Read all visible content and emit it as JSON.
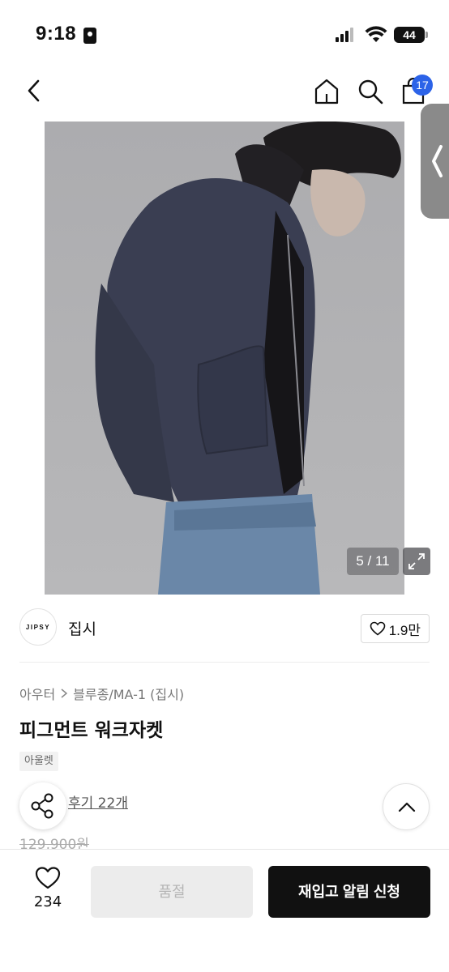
{
  "status_bar": {
    "time": "9:18",
    "battery": "44"
  },
  "nav": {
    "cart_count": "17"
  },
  "gallery": {
    "counter": "5 / 11"
  },
  "brand": {
    "logo_text": "JIPSY",
    "name": "집시",
    "likes": "1.9만"
  },
  "product": {
    "breadcrumb": [
      "아우터",
      "블루종/MA-1 (집시)"
    ],
    "title": "피그먼트 워크자켓",
    "badge": "아울렛",
    "review_link": "후기 22개",
    "original_price": "129,900원"
  },
  "bottom_bar": {
    "wish_count": "234",
    "soldout_label": "품절",
    "restock_label": "재입고 알림 신청"
  },
  "colors": {
    "badge_blue": "#2c63e8",
    "primary_black": "#111111",
    "disabled_gray": "#ececec"
  }
}
